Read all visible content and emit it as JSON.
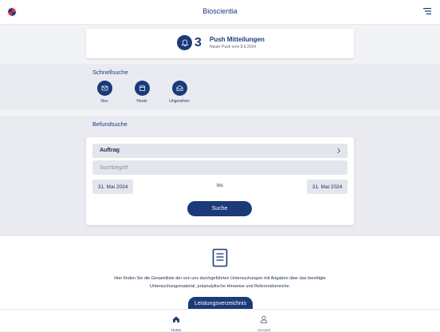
{
  "header": {
    "title": "Bioscientia",
    "menu_icon": "hamburger-icon"
  },
  "push": {
    "count": "3",
    "title": "Push Mitteilungen",
    "subtitle": "Neuer Push vom 8.6.2024",
    "icon": "bell-icon"
  },
  "schnellsuche": {
    "title": "Schnellsuche",
    "buttons": [
      {
        "label": "Neu",
        "icon": "mail-icon"
      },
      {
        "label": "Heute",
        "icon": "calendar-icon"
      },
      {
        "label": "Ungesehen",
        "icon": "open-envelope-icon"
      }
    ]
  },
  "befundsuche": {
    "title": "Befundsuche",
    "auftrag_label": "Auftrag",
    "search_placeholder": "Suchbegriff",
    "date_from": "31. Mai 2024",
    "date_separator": "bis",
    "date_to": "31. Mai 2024",
    "search_button": "Suche"
  },
  "info": {
    "text": "Hier finden Sie die Gesamtliste der von uns durchgeführten Untersuchungen mit Angaben über das benötigte Untersuchungsmaterial, präanalytische Hinweise und Referenzbereiche.",
    "button": "Leistungsverzeichnis",
    "icon": "document-icon"
  },
  "bottom_nav": {
    "items": [
      {
        "label": "Home",
        "icon": "home-icon",
        "active": true
      },
      {
        "label": "Account",
        "icon": "user-icon",
        "active": false
      }
    ]
  },
  "colors": {
    "primary": "#1b3a7a",
    "background": "#f2f3f6",
    "section": "#e9ebf1",
    "input": "#e4e6ee"
  }
}
